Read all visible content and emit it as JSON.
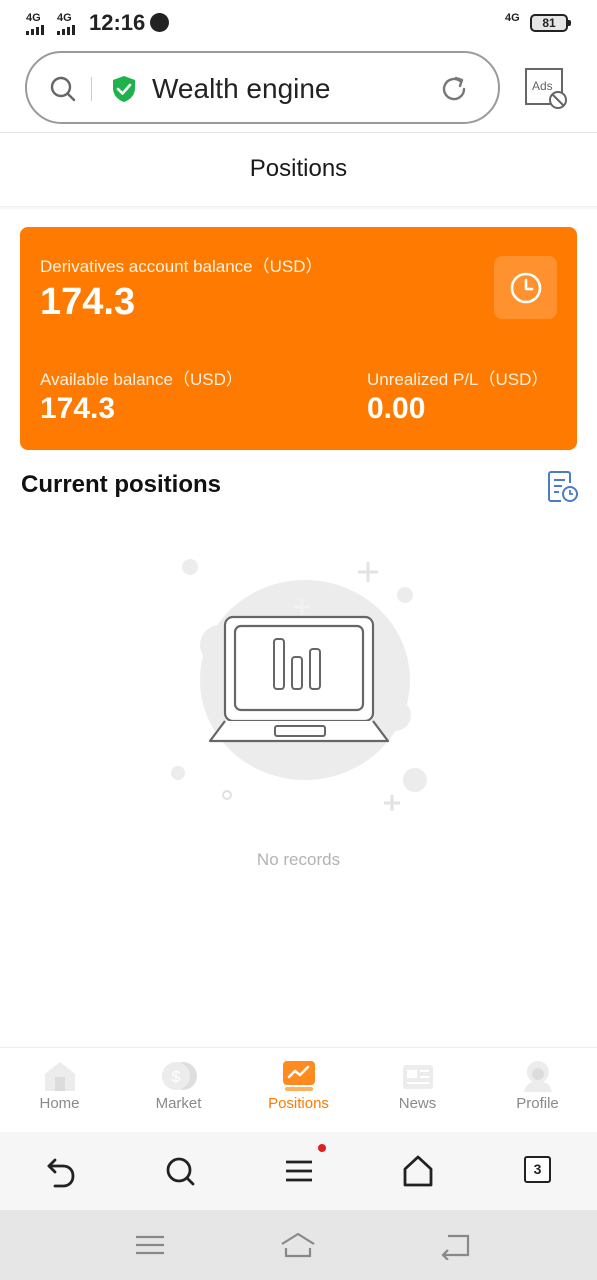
{
  "status_bar": {
    "sim1": "4G",
    "sim2": "4G",
    "time": "12:16",
    "net_type": "4G",
    "battery": "81"
  },
  "browser": {
    "search_title": "Wealth engine",
    "ads_label": "Ads",
    "tab_count": "3"
  },
  "page": {
    "title": "Positions"
  },
  "card": {
    "derivatives_label": "Derivatives account balance（USD）",
    "derivatives_value": "174.3",
    "available_label": "Available balance（USD）",
    "available_value": "174.3",
    "unrealized_label": "Unrealized P/L（USD）",
    "unrealized_value": "0.00",
    "accent_color": "#ff7a00"
  },
  "positions": {
    "section_title": "Current positions",
    "empty_text": "No records"
  },
  "bottom_nav": {
    "items": [
      {
        "label": "Home",
        "icon": "home-icon"
      },
      {
        "label": "Market",
        "icon": "coin-icon"
      },
      {
        "label": "Positions",
        "icon": "chart-icon"
      },
      {
        "label": "News",
        "icon": "news-icon"
      },
      {
        "label": "Profile",
        "icon": "profile-icon"
      }
    ],
    "active": "Positions"
  }
}
